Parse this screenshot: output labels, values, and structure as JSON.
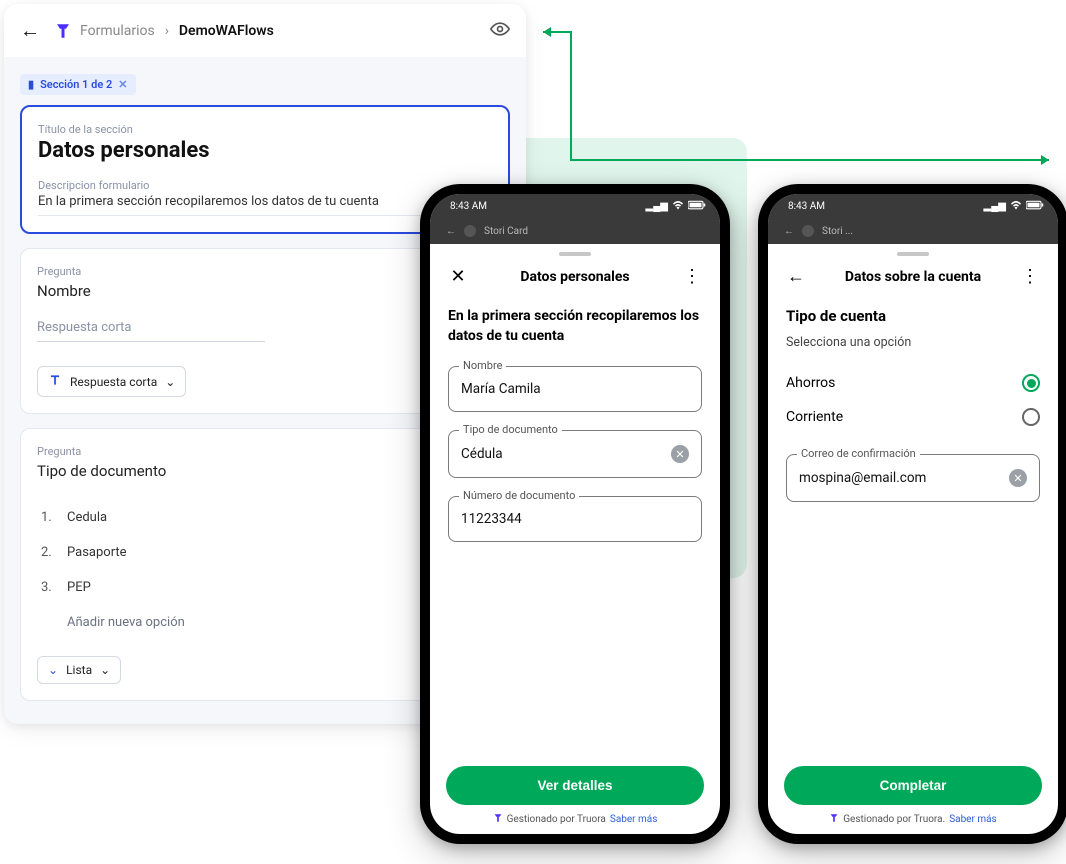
{
  "editor": {
    "breadcrumb_root": "Formularios",
    "breadcrumb_active": "DemoWAFlows",
    "section_chip": "Sección 1 de 2",
    "card1": {
      "title_label": "Título de la sección",
      "title": "Datos personales",
      "desc_label": "Descripcion formulario",
      "desc": "En la primera sección recopilaremos los datos de tu cuenta"
    },
    "card2": {
      "q_label": "Pregunta",
      "q_title": "Nombre",
      "answer_placeholder": "Respuesta corta",
      "type_label": "Respuesta corta"
    },
    "card3": {
      "q_label": "Pregunta",
      "q_title": "Tipo de documento",
      "options": [
        "Cedula",
        "Pasaporte",
        "PEP"
      ],
      "add_option": "Añadir nueva opción",
      "type_label": "Lista"
    }
  },
  "phone1": {
    "time": "8:43 AM",
    "app_bar": "Stori Card",
    "title": "Datos personales",
    "intro": "En la primera sección recopilaremos los datos de tu cuenta",
    "f1_label": "Nombre",
    "f1_value": "María Camila",
    "f2_label": "Tipo de documento",
    "f2_value": "Cédula",
    "f3_label": "Número de documento",
    "f3_value": "11223344",
    "cta": "Ver detalles",
    "managed": "Gestionado por Truora",
    "managed_link": "Saber más"
  },
  "phone2": {
    "time": "8:43 AM",
    "app_bar": "Stori ...",
    "title": "Datos sobre la cuenta",
    "section_h": "Tipo de cuenta",
    "section_sub": "Selecciona una opción",
    "opt1": "Ahorros",
    "opt2": "Corriente",
    "f1_label": "Correo de confirmación",
    "f1_value": "mospina@email.com",
    "cta": "Completar",
    "managed": "Gestionado por Truora.",
    "managed_link": "Saber más"
  }
}
